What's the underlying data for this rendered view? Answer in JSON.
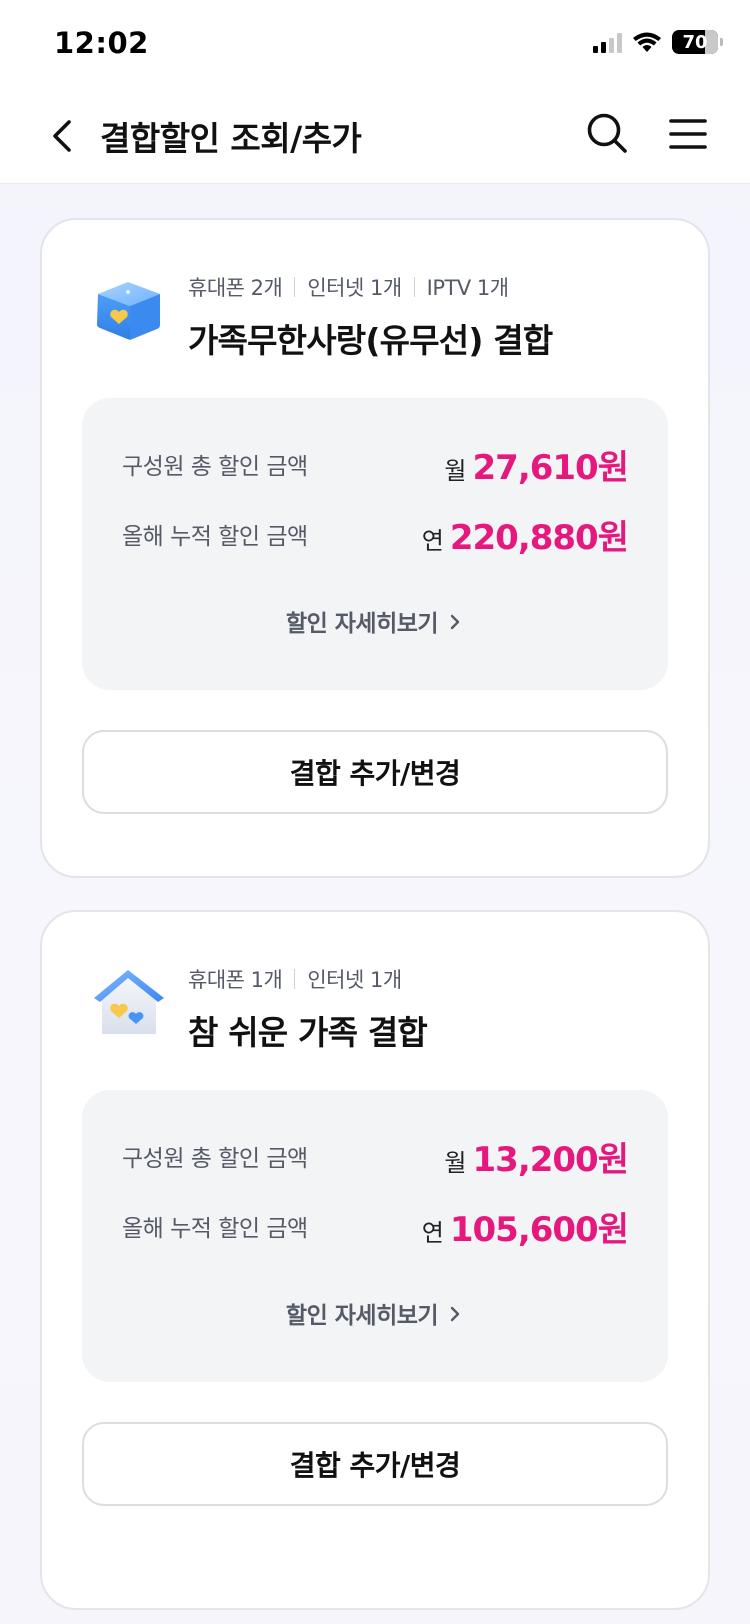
{
  "status_bar": {
    "time": "12:02",
    "battery": "70"
  },
  "header": {
    "title": "결합할인 조회/추가",
    "icons": [
      "back-icon",
      "search-icon",
      "menu-icon"
    ]
  },
  "cards": [
    {
      "icon": "gift-box-heart-icon",
      "tags": [
        "휴대폰 2개",
        "인터넷 1개",
        "IPTV 1개"
      ],
      "title": "가족무한사랑(유무선) 결합",
      "rows": [
        {
          "label": "구성원 총 할인 금액",
          "prefix": "월",
          "amount": "27,610원"
        },
        {
          "label": "올해 누적 할인 금액",
          "prefix": "연",
          "amount": "220,880원"
        }
      ],
      "detail_link": "할인 자세히보기",
      "action_button": "결합 추가/변경"
    },
    {
      "icon": "house-hearts-icon",
      "tags": [
        "휴대폰 1개",
        "인터넷 1개"
      ],
      "title": "참 쉬운 가족 결합",
      "rows": [
        {
          "label": "구성원 총 할인 금액",
          "prefix": "월",
          "amount": "13,200원"
        },
        {
          "label": "올해 누적 할인 금액",
          "prefix": "연",
          "amount": "105,600원"
        }
      ],
      "detail_link": "할인 자세히보기",
      "action_button": "결합 추가/변경"
    }
  ],
  "colors": {
    "accent_pink": "#e5187e",
    "label_gray": "#555a66",
    "box_gray": "#f3f4f6"
  }
}
